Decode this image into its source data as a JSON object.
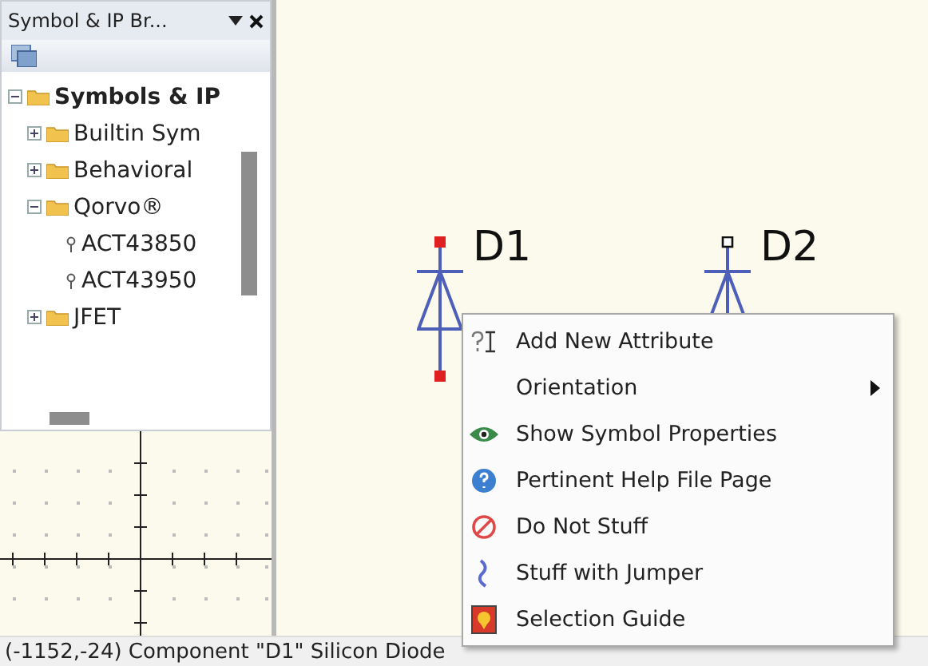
{
  "panel": {
    "title": "Symbol & IP Br...",
    "tree": [
      {
        "label": "Symbols & IP",
        "kind": "folder",
        "expanded": true,
        "children": [
          {
            "label": "Builtin Sym",
            "kind": "folder",
            "expanded": false
          },
          {
            "label": "Behavioral",
            "kind": "folder",
            "expanded": false
          },
          {
            "label": "Qorvo®",
            "kind": "folder",
            "expanded": true,
            "children": [
              {
                "label": "ACT43850",
                "kind": "part"
              },
              {
                "label": "ACT43950",
                "kind": "part"
              }
            ]
          },
          {
            "label": "JFET",
            "kind": "folder",
            "expanded": false
          }
        ]
      }
    ]
  },
  "canvas": {
    "components": [
      {
        "label": "D1",
        "selected": true
      },
      {
        "label": "D2",
        "selected": false
      }
    ]
  },
  "context_menu": {
    "items": [
      {
        "label": "Add New Attribute",
        "kind": "attribute",
        "submenu": false
      },
      {
        "label": "Orientation",
        "kind": "none",
        "submenu": true
      },
      {
        "label": "Show Symbol Properties",
        "kind": "eye",
        "submenu": false
      },
      {
        "label": "Pertinent Help File Page",
        "kind": "help",
        "submenu": false
      },
      {
        "label": "Do Not Stuff",
        "kind": "forbidden",
        "submenu": false
      },
      {
        "label": "Stuff with Jumper",
        "kind": "jumper",
        "submenu": false
      },
      {
        "label": "Selection Guide",
        "kind": "guide",
        "submenu": false
      }
    ]
  },
  "status_bar": "(-1152,-24) Component \"D1\" Silicon Diode"
}
